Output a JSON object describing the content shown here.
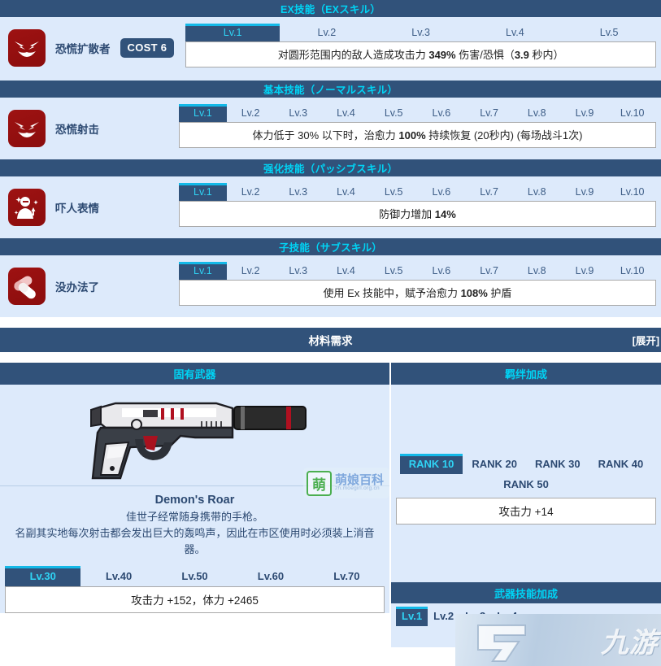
{
  "sections": {
    "ex": {
      "header": "EX技能（EXスキル）",
      "skill_name": "恐慌扩散者",
      "cost_label": "COST 6",
      "icon": "demon-face-icon",
      "levels": [
        "Lv.1",
        "Lv.2",
        "Lv.3",
        "Lv.4",
        "Lv.5"
      ],
      "active_level": "Lv.1",
      "description_parts": [
        {
          "t": "对圆形范围内的敌人造成攻击力 ",
          "b": false
        },
        {
          "t": "349%",
          "b": true
        },
        {
          "t": " 伤害/恐惧（",
          "b": false
        },
        {
          "t": "3.9",
          "b": true
        },
        {
          "t": " 秒内）",
          "b": false
        }
      ]
    },
    "normal": {
      "header": "基本技能（ノーマルスキル）",
      "skill_name": "恐慌射击",
      "icon": "demon-face-icon",
      "levels": [
        "Lv.1",
        "Lv.2",
        "Lv.3",
        "Lv.4",
        "Lv.5",
        "Lv.6",
        "Lv.7",
        "Lv.8",
        "Lv.9",
        "Lv.10"
      ],
      "active_level": "Lv.1",
      "description_parts": [
        {
          "t": "体力低于 30% 以下时，治愈力 ",
          "b": false
        },
        {
          "t": "100%",
          "b": true
        },
        {
          "t": " 持续恢复 (20秒内) (每场战斗1次)",
          "b": false
        }
      ]
    },
    "passive": {
      "header": "强化技能（パッシブスキル）",
      "skill_name": "吓人表情",
      "icon": "scary-face-icon",
      "levels": [
        "Lv.1",
        "Lv.2",
        "Lv.3",
        "Lv.4",
        "Lv.5",
        "Lv.6",
        "Lv.7",
        "Lv.8",
        "Lv.9",
        "Lv.10"
      ],
      "active_level": "Lv.1",
      "description_parts": [
        {
          "t": "防御力增加 ",
          "b": false
        },
        {
          "t": "14%",
          "b": true
        }
      ]
    },
    "sub": {
      "header": "子技能（サブスキル）",
      "skill_name": "没办法了",
      "icon": "capsule-pills-icon",
      "levels": [
        "Lv.1",
        "Lv.2",
        "Lv.3",
        "Lv.4",
        "Lv.5",
        "Lv.6",
        "Lv.7",
        "Lv.8",
        "Lv.9",
        "Lv.10"
      ],
      "active_level": "Lv.1",
      "description_parts": [
        {
          "t": "使用 Ex 技能中，赋予治愈力 ",
          "b": false
        },
        {
          "t": "108%",
          "b": true
        },
        {
          "t": " 护盾",
          "b": false
        }
      ]
    }
  },
  "materials": {
    "title": "材料需求",
    "expand_label": "[展开]"
  },
  "weapon": {
    "column_header": "固有武器",
    "image": "pistol-with-suppressor-icon",
    "name": "Demon's Roar",
    "description_line1": "佳世子经常随身携带的手枪。",
    "description_line2": "名副其实地每次射击都会发出巨大的轰鸣声，因此在市区使用时必须装上消音器。",
    "levels": [
      "Lv.30",
      "Lv.40",
      "Lv.50",
      "Lv.60",
      "Lv.70"
    ],
    "active_level": "Lv.30",
    "stat_text": "攻击力 +152，体力 +2465"
  },
  "bond": {
    "column_header": "羁绊加成",
    "ranks_row1": [
      "RANK 10",
      "RANK 20",
      "RANK 30",
      "RANK 40"
    ],
    "ranks_row2": [
      "RANK 50"
    ],
    "active_rank": "RANK 10",
    "stat_text": "攻击力 +14"
  },
  "weapon_skill": {
    "header": "武器技能加成",
    "levels": [
      "Lv.1",
      "Lv.2",
      "Lv.3",
      "Lv.4"
    ],
    "active_level": "Lv.1"
  },
  "watermarks": {
    "moegirl_logo": "萌",
    "moegirl_name": "萌娘百科",
    "moegirl_url": "zh.moegirl.org.cn",
    "jiuyou": "九游"
  },
  "colors": {
    "header_bar": "#31527a",
    "header_text": "#00d4f5",
    "block_bg": "#ddeafb",
    "icon_bg": "#9b1111",
    "accent_top": "#13b9e8"
  }
}
